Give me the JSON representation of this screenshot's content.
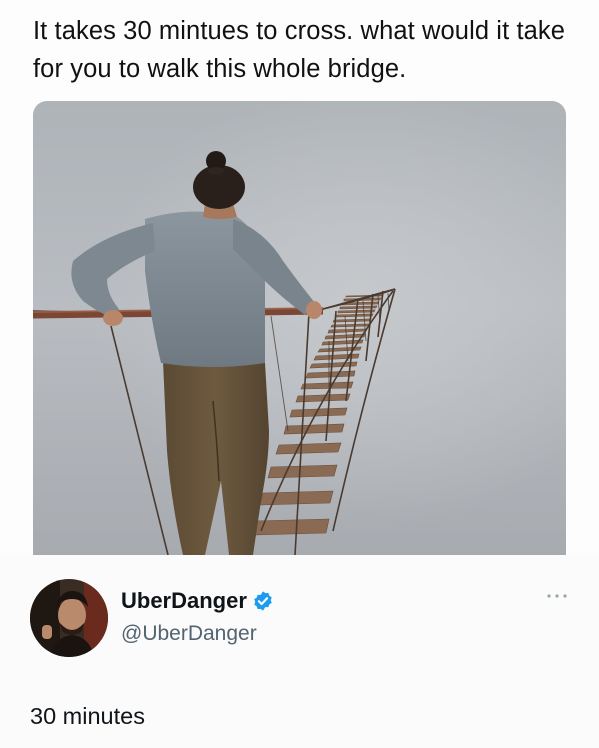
{
  "post": {
    "caption": "It takes 30 mintues to cross. what would it take for you to walk this whole bridge."
  },
  "photo": {
    "content": "person-crossing-rope-bridge-into-fog"
  },
  "reply": {
    "display_name": "UberDanger",
    "handle": "@UberDanger",
    "text": "30 minutes",
    "verified_color": "#1d9bf0",
    "avatar_icon": "user-avatar",
    "more_icon": "more-options-icon"
  }
}
